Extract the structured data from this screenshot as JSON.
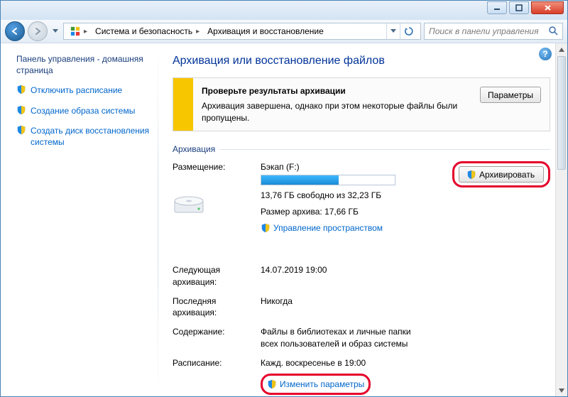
{
  "titlebar": {},
  "nav": {
    "breadcrumb": [
      "Система и безопасность",
      "Архивация и восстановление"
    ],
    "search_placeholder": "Поиск в панели управления"
  },
  "sidebar": {
    "home": "Панель управления - домашняя страница",
    "links": [
      "Отключить расписание",
      "Создание образа системы",
      "Создать диск восстановления системы"
    ]
  },
  "page": {
    "title": "Архивация или восстановление файлов",
    "banner": {
      "heading": "Проверьте результаты архивации",
      "body": "Архивация завершена, однако при этом некоторые файлы были пропущены.",
      "button": "Параметры"
    },
    "group_title": "Архивация",
    "backup_button": "Архивировать",
    "rows": {
      "location_label": "Размещение:",
      "location_value": "Бэкап (F:)",
      "free_space": "13,76 ГБ свободно из 32,23 ГБ",
      "archive_size": "Размер архива: 17,66 ГБ",
      "manage_space": "Управление пространством",
      "next_label": "Следующая архивация:",
      "next_value": "14.07.2019 19:00",
      "last_label": "Последняя архивация:",
      "last_value": "Никогда",
      "content_label": "Содержание:",
      "content_value": "Файлы в библиотеках и личные папки всех пользователей и образ системы",
      "schedule_label": "Расписание:",
      "schedule_value": "Кажд. воскресенье в 19:00",
      "change_params": "Изменить параметры"
    },
    "progress_pct": 58
  }
}
